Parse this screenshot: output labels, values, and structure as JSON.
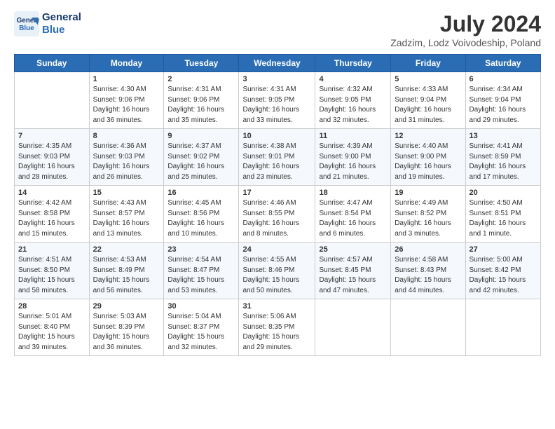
{
  "logo": {
    "line1": "General",
    "line2": "Blue"
  },
  "title": "July 2024",
  "subtitle": "Zadzim, Lodz Voivodeship, Poland",
  "weekdays": [
    "Sunday",
    "Monday",
    "Tuesday",
    "Wednesday",
    "Thursday",
    "Friday",
    "Saturday"
  ],
  "weeks": [
    [
      {
        "day": "",
        "info": ""
      },
      {
        "day": "1",
        "info": "Sunrise: 4:30 AM\nSunset: 9:06 PM\nDaylight: 16 hours\nand 36 minutes."
      },
      {
        "day": "2",
        "info": "Sunrise: 4:31 AM\nSunset: 9:06 PM\nDaylight: 16 hours\nand 35 minutes."
      },
      {
        "day": "3",
        "info": "Sunrise: 4:31 AM\nSunset: 9:05 PM\nDaylight: 16 hours\nand 33 minutes."
      },
      {
        "day": "4",
        "info": "Sunrise: 4:32 AM\nSunset: 9:05 PM\nDaylight: 16 hours\nand 32 minutes."
      },
      {
        "day": "5",
        "info": "Sunrise: 4:33 AM\nSunset: 9:04 PM\nDaylight: 16 hours\nand 31 minutes."
      },
      {
        "day": "6",
        "info": "Sunrise: 4:34 AM\nSunset: 9:04 PM\nDaylight: 16 hours\nand 29 minutes."
      }
    ],
    [
      {
        "day": "7",
        "info": "Sunrise: 4:35 AM\nSunset: 9:03 PM\nDaylight: 16 hours\nand 28 minutes."
      },
      {
        "day": "8",
        "info": "Sunrise: 4:36 AM\nSunset: 9:03 PM\nDaylight: 16 hours\nand 26 minutes."
      },
      {
        "day": "9",
        "info": "Sunrise: 4:37 AM\nSunset: 9:02 PM\nDaylight: 16 hours\nand 25 minutes."
      },
      {
        "day": "10",
        "info": "Sunrise: 4:38 AM\nSunset: 9:01 PM\nDaylight: 16 hours\nand 23 minutes."
      },
      {
        "day": "11",
        "info": "Sunrise: 4:39 AM\nSunset: 9:00 PM\nDaylight: 16 hours\nand 21 minutes."
      },
      {
        "day": "12",
        "info": "Sunrise: 4:40 AM\nSunset: 9:00 PM\nDaylight: 16 hours\nand 19 minutes."
      },
      {
        "day": "13",
        "info": "Sunrise: 4:41 AM\nSunset: 8:59 PM\nDaylight: 16 hours\nand 17 minutes."
      }
    ],
    [
      {
        "day": "14",
        "info": "Sunrise: 4:42 AM\nSunset: 8:58 PM\nDaylight: 16 hours\nand 15 minutes."
      },
      {
        "day": "15",
        "info": "Sunrise: 4:43 AM\nSunset: 8:57 PM\nDaylight: 16 hours\nand 13 minutes."
      },
      {
        "day": "16",
        "info": "Sunrise: 4:45 AM\nSunset: 8:56 PM\nDaylight: 16 hours\nand 10 minutes."
      },
      {
        "day": "17",
        "info": "Sunrise: 4:46 AM\nSunset: 8:55 PM\nDaylight: 16 hours\nand 8 minutes."
      },
      {
        "day": "18",
        "info": "Sunrise: 4:47 AM\nSunset: 8:54 PM\nDaylight: 16 hours\nand 6 minutes."
      },
      {
        "day": "19",
        "info": "Sunrise: 4:49 AM\nSunset: 8:52 PM\nDaylight: 16 hours\nand 3 minutes."
      },
      {
        "day": "20",
        "info": "Sunrise: 4:50 AM\nSunset: 8:51 PM\nDaylight: 16 hours\nand 1 minute."
      }
    ],
    [
      {
        "day": "21",
        "info": "Sunrise: 4:51 AM\nSunset: 8:50 PM\nDaylight: 15 hours\nand 58 minutes."
      },
      {
        "day": "22",
        "info": "Sunrise: 4:53 AM\nSunset: 8:49 PM\nDaylight: 15 hours\nand 56 minutes."
      },
      {
        "day": "23",
        "info": "Sunrise: 4:54 AM\nSunset: 8:47 PM\nDaylight: 15 hours\nand 53 minutes."
      },
      {
        "day": "24",
        "info": "Sunrise: 4:55 AM\nSunset: 8:46 PM\nDaylight: 15 hours\nand 50 minutes."
      },
      {
        "day": "25",
        "info": "Sunrise: 4:57 AM\nSunset: 8:45 PM\nDaylight: 15 hours\nand 47 minutes."
      },
      {
        "day": "26",
        "info": "Sunrise: 4:58 AM\nSunset: 8:43 PM\nDaylight: 15 hours\nand 44 minutes."
      },
      {
        "day": "27",
        "info": "Sunrise: 5:00 AM\nSunset: 8:42 PM\nDaylight: 15 hours\nand 42 minutes."
      }
    ],
    [
      {
        "day": "28",
        "info": "Sunrise: 5:01 AM\nSunset: 8:40 PM\nDaylight: 15 hours\nand 39 minutes."
      },
      {
        "day": "29",
        "info": "Sunrise: 5:03 AM\nSunset: 8:39 PM\nDaylight: 15 hours\nand 36 minutes."
      },
      {
        "day": "30",
        "info": "Sunrise: 5:04 AM\nSunset: 8:37 PM\nDaylight: 15 hours\nand 32 minutes."
      },
      {
        "day": "31",
        "info": "Sunrise: 5:06 AM\nSunset: 8:35 PM\nDaylight: 15 hours\nand 29 minutes."
      },
      {
        "day": "",
        "info": ""
      },
      {
        "day": "",
        "info": ""
      },
      {
        "day": "",
        "info": ""
      }
    ]
  ]
}
